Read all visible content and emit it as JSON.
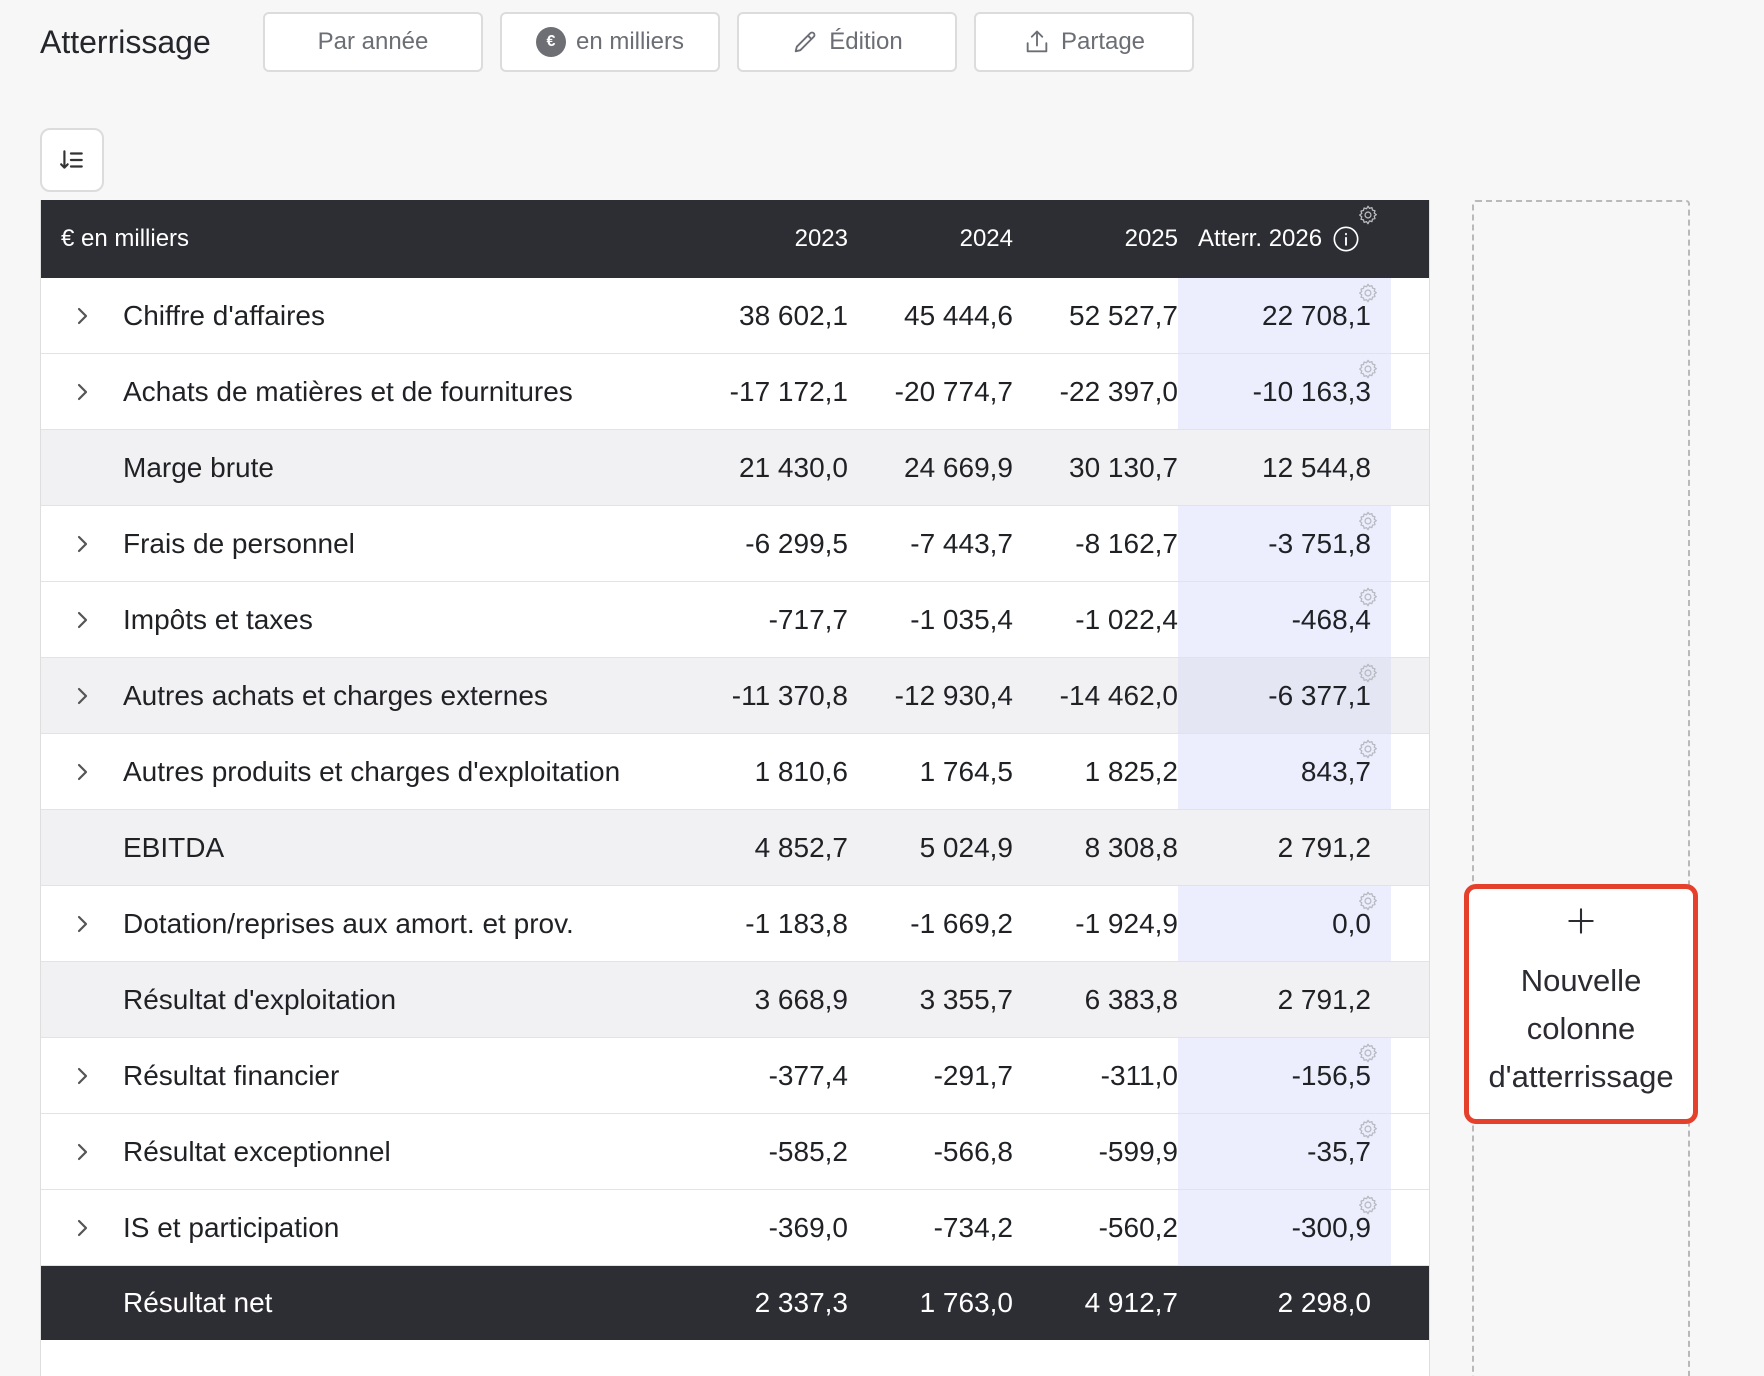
{
  "header": {
    "title": "Atterrissage",
    "btn_period": "Par année",
    "btn_unit": "en milliers",
    "btn_edit": "Édition",
    "btn_share": "Partage"
  },
  "table": {
    "unit_label": "€ en milliers",
    "columns": [
      "2023",
      "2024",
      "2025",
      "Atterr. 2026"
    ],
    "rows": [
      {
        "label": "Chiffre d'affaires",
        "values": [
          "38 602,1",
          "45 444,6",
          "52 527,7",
          "22 708,1"
        ]
      },
      {
        "label": "Achats de matières et de fournitures",
        "values": [
          "-17 172,1",
          "-20 774,7",
          "-22 397,0",
          "-10 163,3"
        ]
      },
      {
        "label": "Marge brute",
        "values": [
          "21 430,0",
          "24 669,9",
          "30 130,7",
          "12 544,8"
        ]
      },
      {
        "label": "Frais de personnel",
        "values": [
          "-6 299,5",
          "-7 443,7",
          "-8 162,7",
          "-3 751,8"
        ]
      },
      {
        "label": "Impôts et taxes",
        "values": [
          "-717,7",
          "-1 035,4",
          "-1 022,4",
          "-468,4"
        ]
      },
      {
        "label": "Autres achats et charges externes",
        "values": [
          "-11 370,8",
          "-12 930,4",
          "-14 462,0",
          "-6 377,1"
        ]
      },
      {
        "label": "Autres produits et charges d'exploitation",
        "values": [
          "1 810,6",
          "1 764,5",
          "1 825,2",
          "843,7"
        ]
      },
      {
        "label": "EBITDA",
        "values": [
          "4 852,7",
          "5 024,9",
          "8 308,8",
          "2 791,2"
        ]
      },
      {
        "label": "Dotation/reprises aux amort. et prov.",
        "values": [
          "-1 183,8",
          "-1 669,2",
          "-1 924,9",
          "0,0"
        ]
      },
      {
        "label": "Résultat d'exploitation",
        "values": [
          "3 668,9",
          "3 355,7",
          "6 383,8",
          "2 791,2"
        ]
      },
      {
        "label": "Résultat financier",
        "values": [
          "-377,4",
          "-291,7",
          "-311,0",
          "-156,5"
        ]
      },
      {
        "label": "Résultat exceptionnel",
        "values": [
          "-585,2",
          "-566,8",
          "-599,9",
          "-35,7"
        ]
      },
      {
        "label": "IS et participation",
        "values": [
          "-369,0",
          "-734,2",
          "-560,2",
          "-300,9"
        ]
      },
      {
        "label": "Résultat net",
        "values": [
          "2 337,3",
          "1 763,0",
          "4 912,7",
          "2 298,0"
        ]
      }
    ]
  },
  "new_column": {
    "line1": "Nouvelle",
    "line2": "colonne",
    "line3": "d'atterrissage"
  },
  "colors": {
    "header_bg": "#2d2e33",
    "editable_cell_bg": "#eceefd",
    "highlight_border": "#e5402c"
  }
}
